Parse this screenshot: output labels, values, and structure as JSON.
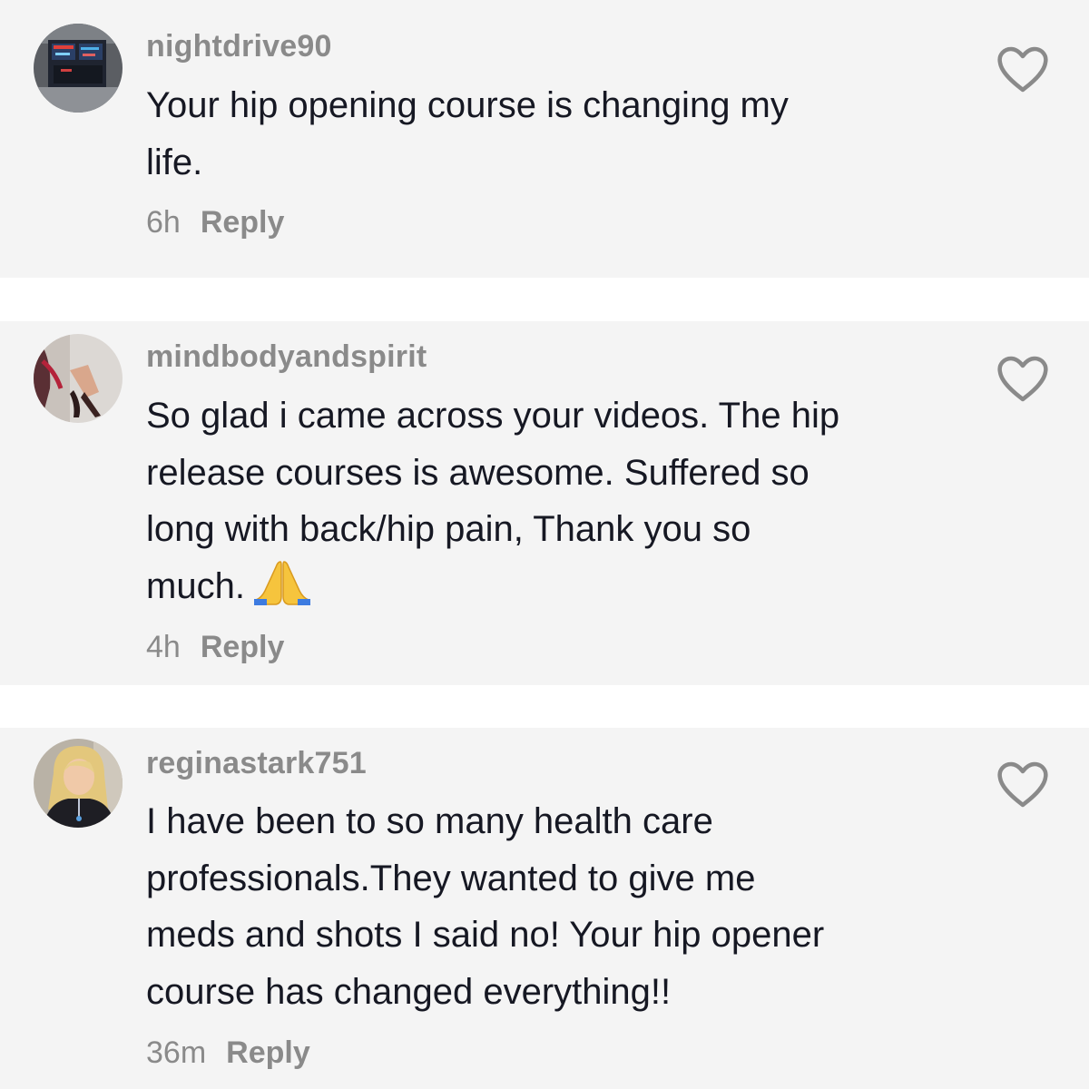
{
  "comments": [
    {
      "username": "nightdrive90",
      "lines": [
        "Your hip opening course is changing my",
        "life."
      ],
      "time": "6h",
      "reply_label": "Reply"
    },
    {
      "username": "mindbodyandspirit",
      "lines": [
        "So glad i came across your videos. The hip",
        "release courses is awesome. Suffered so",
        "long with back/hip pain, Thank you so",
        "much."
      ],
      "emoji_icon": "folded-hands-icon",
      "time": "4h",
      "reply_label": "Reply"
    },
    {
      "username": "reginastark751",
      "lines": [
        "I have been to so many health care",
        "professionals.They wanted to give me",
        "meds and shots I said no! Your hip opener",
        "course has changed everything!!"
      ],
      "time": "36m",
      "reply_label": "Reply"
    }
  ],
  "icons": {
    "like": "heart-outline-icon"
  },
  "colors": {
    "card_background": "#f4f4f4",
    "page_background": "#ffffff",
    "username": "#8a8a8a",
    "comment_text": "#161823",
    "meta_text": "#8a8a8a",
    "heart_stroke": "#8a8a8a"
  }
}
